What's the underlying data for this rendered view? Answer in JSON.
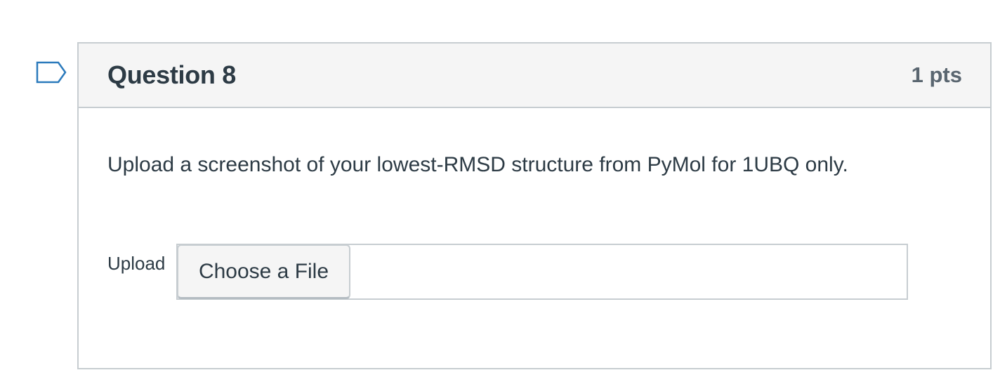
{
  "question": {
    "title": "Question 8",
    "points": "1 pts",
    "text": "Upload a screenshot of your lowest-RMSD structure from PyMol for 1UBQ only.",
    "flag_icon": "flag-outline-icon"
  },
  "upload": {
    "label": "Upload",
    "button_label": "Choose a File"
  },
  "colors": {
    "text": "#2d3b45",
    "header_bg": "#f5f5f5",
    "border": "#c7cdd1",
    "flag_stroke": "#2b7abc"
  }
}
